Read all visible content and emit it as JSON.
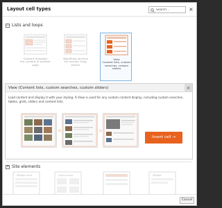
{
  "dialog": {
    "title": "Layout cell types",
    "search": {
      "placeholder": "Search..."
    },
    "close": "×"
  },
  "sections": [
    {
      "toggle": "−",
      "title": "Lists and loops"
    },
    {
      "toggle": "+",
      "title": "Site elements"
    }
  ],
  "lists_and_loops": {
    "cards": [
      {
        "label": "Content Template\nthe content of another\npage"
      },
      {
        "label": "WordPress Archive\nlist archive, blog,\nsearch"
      },
      {
        "label": "View\nContent lists, custom\nsearches, custom\nsliders"
      }
    ]
  },
  "detail": {
    "title": "View (Content lists, custom searches, custom sliders)",
    "close": "×",
    "description": "Load content and display it with your styling. A View is used for any custom content display, including custom searches, tables, grids, sliders and content lists.",
    "insert_button": "Insert cell →"
  },
  "site_elements": {
    "card_labels": [
      "Widget area",
      "Layout loop",
      "",
      "",
      "Widget"
    ]
  },
  "footer": {
    "cancel": "Cancel"
  },
  "colors": {
    "accent": "#e8621f",
    "selection": "#7fb2e0"
  }
}
